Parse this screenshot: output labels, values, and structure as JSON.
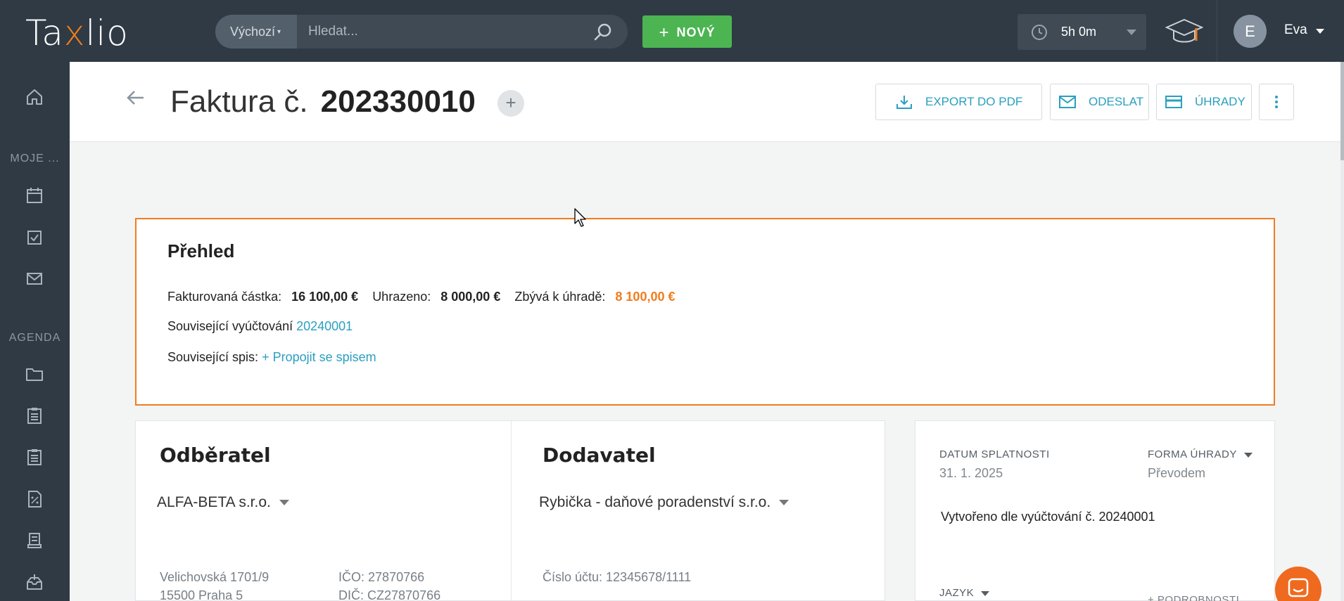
{
  "app": {
    "logo_pre": "Ta",
    "logo_x": "x",
    "logo_post": "lio"
  },
  "search": {
    "scope": "Výchozí",
    "placeholder": "Hledat..."
  },
  "new_button": {
    "label": "NOVÝ"
  },
  "timer": {
    "value": "5h 0m"
  },
  "user": {
    "initial": "E",
    "name": "Eva"
  },
  "sidebar": {
    "section_mine": "MOJE ...",
    "section_agenda": "AGENDA",
    "icons": [
      "home-icon",
      "calendar-icon",
      "task-check-icon",
      "mail-icon",
      "folder-icon",
      "clipboard-icon",
      "clipboard-icon",
      "percent-document-icon",
      "receipt-icon",
      "inbox-icon"
    ]
  },
  "page": {
    "title_prefix": "Faktura č.",
    "title_number": "202330010",
    "actions": {
      "export": "EXPORT DO PDF",
      "send": "ODESLAT",
      "payments": "ÚHRADY"
    }
  },
  "overview": {
    "heading": "Přehled",
    "invoiced_label": "Fakturovaná částka:",
    "invoiced_value": "16 100,00 €",
    "paid_label": "Uhrazeno:",
    "paid_value": "8 000,00 €",
    "remaining_label": "Zbývá k úhradě:",
    "remaining_value": "8 100,00 €",
    "billing_label": "Související vyúčtování",
    "billing_link": "20240001",
    "file_label": "Související spis:",
    "file_link": "+ Propojit se spisem"
  },
  "customer": {
    "heading": "Odběratel",
    "name": "ALFA-BETA s.r.o.",
    "street": "Velichovská 1701/9",
    "city": "15500 Praha 5",
    "ico_label": "IČO:",
    "ico": "27870766",
    "dic_label": "DIČ:",
    "dic": "CZ27870766"
  },
  "supplier": {
    "heading": "Dodavatel",
    "name": "Rybička - daňové poradenství s.r.o.",
    "account": "Číslo účtu: 12345678/1111"
  },
  "details": {
    "due_label": "DATUM SPLATNOSTI",
    "due_value": "31. 1. 2025",
    "payment_label": "FORMA ÚHRADY",
    "payment_value": "Převodem",
    "note": "Vytvořeno dle vyúčtování č. 20240001",
    "language_label": "JAZYK",
    "more_label": "+ PODROBNOSTI"
  },
  "colors": {
    "topbar": "#2f3a44",
    "accent_orange": "#f07d1e",
    "link_blue": "#2a9fc0",
    "new_green": "#4cb552"
  }
}
